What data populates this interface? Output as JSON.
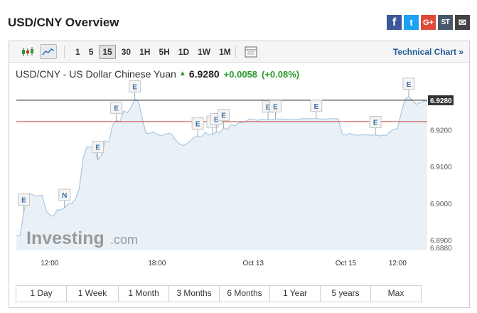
{
  "page_title": "USD/CNY Overview",
  "share": {
    "items": [
      {
        "name": "facebook-share-button",
        "glyph": "f",
        "cls": "fb"
      },
      {
        "name": "twitter-share-button",
        "glyph": "t",
        "cls": "tw"
      },
      {
        "name": "google-plus-share-button",
        "glyph": "G+",
        "cls": "gp"
      },
      {
        "name": "stocktwits-share-button",
        "glyph": "ST",
        "cls": "st"
      },
      {
        "name": "email-share-button",
        "glyph": "✉",
        "cls": "em"
      }
    ]
  },
  "toolbar": {
    "icons": [
      "candlestick-chart-icon",
      "area-chart-icon",
      "calendar-table-icon"
    ],
    "intervals": [
      "1",
      "5",
      "15",
      "30",
      "1H",
      "5H",
      "1D",
      "1W",
      "1M"
    ],
    "active_interval": "15",
    "technical_link": "Technical Chart »"
  },
  "quote": {
    "name": "USD/CNY - US Dollar Chinese Yuan",
    "last": "6.9280",
    "change": "+0.0058",
    "change_pct": "(+0.08%)",
    "direction_icon": "up-arrow-icon"
  },
  "watermark": {
    "brand": "Investing",
    "suffix": ".com"
  },
  "colors": {
    "line": "#a9c6df",
    "fill": "#e9f1f7",
    "current_line": "#222222",
    "prev_close_line": "#c0392b",
    "positive": "#2b9b2b",
    "link": "#1f5a99"
  },
  "chart_data": {
    "type": "area",
    "series": [
      {
        "values": [
          6.8912,
          6.8912,
          6.8975,
          6.9025,
          6.9025,
          6.902,
          6.902,
          6.9022,
          6.898,
          6.8968,
          6.8965,
          6.8982,
          6.8982,
          6.8988,
          6.8998,
          6.9,
          6.9012,
          6.904,
          6.912,
          6.9153,
          6.9153,
          6.9153,
          6.9118,
          6.9131,
          6.917,
          6.9166,
          6.9212,
          6.9225,
          6.9222,
          6.9251,
          6.9246,
          6.926,
          6.9283,
          6.9276,
          6.9232,
          6.919,
          6.919,
          6.9194,
          6.9188,
          6.9183,
          6.9187,
          6.919,
          6.9188,
          6.9172,
          6.9162,
          6.9157,
          6.9161,
          6.917,
          6.918,
          6.9182,
          6.918,
          6.9193,
          6.9186,
          6.9187,
          6.9194,
          6.9192,
          6.9205,
          6.92,
          6.9214,
          6.921,
          6.9218,
          6.922,
          6.9223,
          6.9229,
          6.9228,
          6.9226,
          6.9227,
          6.9228,
          6.9228,
          6.9228,
          6.9229,
          6.9229,
          6.9229,
          6.9228,
          6.9228,
          6.9228,
          6.9228,
          6.923,
          6.923,
          6.923,
          6.923,
          6.923,
          6.9229,
          6.9229,
          6.9229,
          6.923,
          6.923,
          6.9229,
          6.9189,
          6.9185,
          6.919,
          6.9186,
          6.9185,
          6.9186,
          6.9186,
          6.9186,
          6.9185,
          6.9186,
          6.9183,
          6.9185,
          6.9185,
          6.9195,
          6.9201,
          6.9203,
          6.9246,
          6.9282,
          6.929,
          6.9279,
          6.9269,
          6.9273,
          6.9278,
          6.9278
        ]
      }
    ],
    "current_value": 6.928,
    "prev_close": 6.9222,
    "ylim": [
      6.8872,
      6.9305
    ],
    "y_ticks": [
      6.888,
      6.89,
      6.9,
      6.91,
      6.92
    ],
    "y_tick_labels": [
      "6.8880",
      "6.8900",
      "6.9000",
      "6.9100",
      "6.9200"
    ],
    "current_label": "6.9280",
    "x_ticks": [
      {
        "index": 9,
        "label": "12:00"
      },
      {
        "index": 38,
        "label": "18:00"
      },
      {
        "index": 64,
        "label": "Oct 13"
      },
      {
        "index": 89,
        "label": "Oct 15"
      },
      {
        "index": 103,
        "label": "12:00"
      }
    ],
    "events": [
      {
        "index": 2,
        "label": "E"
      },
      {
        "index": 13,
        "label": "N"
      },
      {
        "index": 22,
        "label": "E"
      },
      {
        "index": 27,
        "label": "E"
      },
      {
        "index": 32,
        "label": "E"
      },
      {
        "index": 49,
        "label": "E"
      },
      {
        "index": 53,
        "label": "E"
      },
      {
        "index": 54,
        "label": "E"
      },
      {
        "index": 56,
        "label": "E"
      },
      {
        "index": 68,
        "label": "E"
      },
      {
        "index": 70,
        "label": "E"
      },
      {
        "index": 81,
        "label": "E"
      },
      {
        "index": 97,
        "label": "E"
      },
      {
        "index": 106,
        "label": "E"
      }
    ],
    "grid": false,
    "legend": "none"
  },
  "ranges": [
    "1 Day",
    "1 Week",
    "1 Month",
    "3 Months",
    "6 Months",
    "1 Year",
    "5 years",
    "Max"
  ]
}
